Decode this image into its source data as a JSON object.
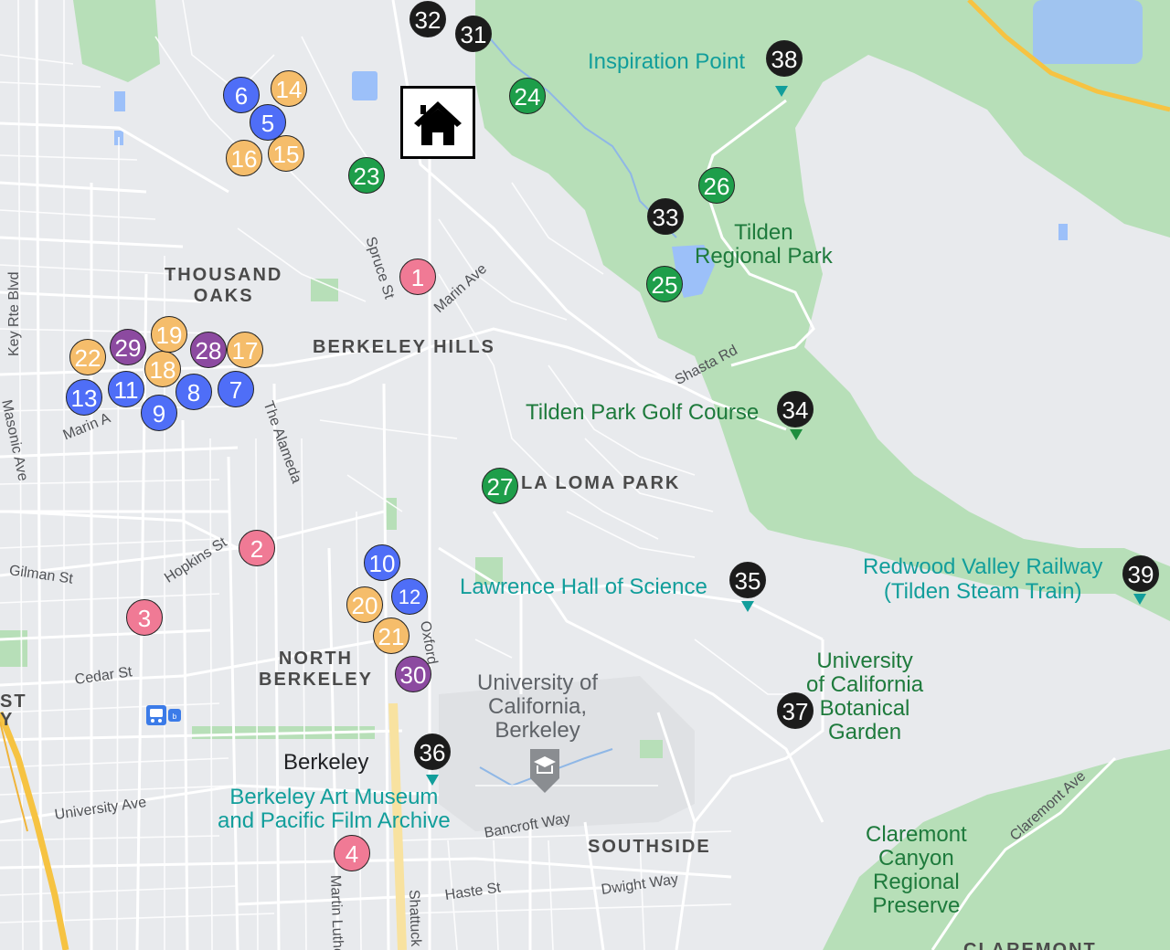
{
  "colors": {
    "pink": "#f07a95",
    "orange": "#f5bd6b",
    "blue": "#4f6ef7",
    "purple": "#8c4aa0",
    "green": "#1e9e4a",
    "black": "#1c1c1c",
    "park_fill": "#b7dfb8",
    "road": "#ffffff",
    "highway": "#f6c342",
    "water": "#9cc0f9",
    "land": "#e8eaed"
  },
  "icons": {
    "home": "house-icon",
    "transit": "bus-train-icon",
    "campus": "graduation-cap-icon",
    "poi_pin": "map-pin-icon"
  },
  "labels": {
    "areas": {
      "thousand_oaks": "THOUSAND\nOAKS",
      "berkeley_hills": "BERKELEY HILLS",
      "la_loma_park": "LA LOMA PARK",
      "north_berkeley": "NORTH\nBERKELEY",
      "southside": "SOUTHSIDE",
      "claremont": "CLAREMONT",
      "st_edge": "ST\nY"
    },
    "parks": {
      "tilden": "Tilden\nRegional Park",
      "golf": "Tilden Park Golf Course",
      "claremont_canyon": "Claremont\nCanyon\nRegional\nPreserve",
      "botanical": "University\nof California\nBotanical\nGarden"
    },
    "pois": {
      "inspiration": "Inspiration Point",
      "lawrence": "Lawrence Hall of Science",
      "redwood": "Redwood Valley Railway\n(Tilden Steam Train)",
      "museum": "Berkeley Art Museum\nand Pacific Film Archive"
    },
    "campus": "University of\nCalifornia,\nBerkeley",
    "city": "Berkeley",
    "streets": {
      "spruce": "Spruce St",
      "marin_ave": "Marin Ave",
      "key_rte": "Key Rte Blvd",
      "masonic": "Masonic Ave",
      "marin_w": "Marin A",
      "alameda": "The Alameda",
      "hopkins": "Hopkins St",
      "gilman": "Gilman St",
      "cedar": "Cedar St",
      "oxford": "Oxford",
      "university": "University Ave",
      "bancroft": "Bancroft Way",
      "dwight": "Dwight Way",
      "haste": "Haste St",
      "shattuck": "Shattuck",
      "mlk": "Martin Luthe",
      "shasta": "Shasta Rd",
      "claremont_ave": "Claremont Ave"
    }
  },
  "markers": [
    {
      "n": "1",
      "color": "pink"
    },
    {
      "n": "2",
      "color": "pink"
    },
    {
      "n": "3",
      "color": "pink"
    },
    {
      "n": "4",
      "color": "pink"
    },
    {
      "n": "5",
      "color": "blue"
    },
    {
      "n": "6",
      "color": "blue"
    },
    {
      "n": "7",
      "color": "blue"
    },
    {
      "n": "8",
      "color": "blue"
    },
    {
      "n": "9",
      "color": "blue"
    },
    {
      "n": "10",
      "color": "blue"
    },
    {
      "n": "11",
      "color": "blue"
    },
    {
      "n": "12",
      "color": "blue"
    },
    {
      "n": "13",
      "color": "blue"
    },
    {
      "n": "14",
      "color": "orange"
    },
    {
      "n": "15",
      "color": "orange"
    },
    {
      "n": "16",
      "color": "orange"
    },
    {
      "n": "17",
      "color": "orange"
    },
    {
      "n": "18",
      "color": "orange"
    },
    {
      "n": "19",
      "color": "orange"
    },
    {
      "n": "20",
      "color": "orange"
    },
    {
      "n": "21",
      "color": "orange"
    },
    {
      "n": "22",
      "color": "orange"
    },
    {
      "n": "23",
      "color": "green"
    },
    {
      "n": "24",
      "color": "green"
    },
    {
      "n": "25",
      "color": "green"
    },
    {
      "n": "26",
      "color": "green"
    },
    {
      "n": "27",
      "color": "green"
    },
    {
      "n": "28",
      "color": "purple"
    },
    {
      "n": "29",
      "color": "purple"
    },
    {
      "n": "30",
      "color": "purple"
    },
    {
      "n": "31",
      "color": "black"
    },
    {
      "n": "32",
      "color": "black"
    },
    {
      "n": "33",
      "color": "black"
    },
    {
      "n": "34",
      "color": "black"
    },
    {
      "n": "35",
      "color": "black"
    },
    {
      "n": "36",
      "color": "black"
    },
    {
      "n": "37",
      "color": "black"
    },
    {
      "n": "38",
      "color": "black"
    },
    {
      "n": "39",
      "color": "black"
    }
  ]
}
